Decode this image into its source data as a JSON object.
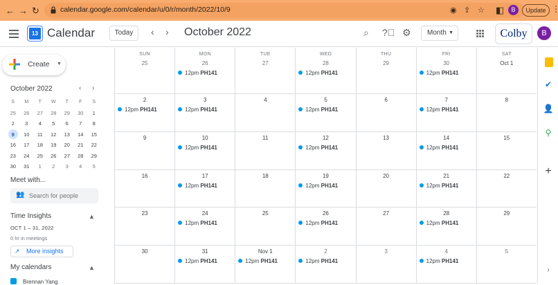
{
  "browser": {
    "url": "calendar.google.com/calendar/u/0/r/month/2022/10/9",
    "profile_initial": "B",
    "update_label": "Update"
  },
  "header": {
    "app_name": "Calendar",
    "logo_day": "13",
    "today_label": "Today",
    "month_title": "October 2022",
    "view_label": "Month",
    "org_logo": "Colby",
    "avatar_initial": "B"
  },
  "sidebar": {
    "create_label": "Create",
    "mini_month": "October 2022",
    "mini_weekdays": [
      "S",
      "M",
      "T",
      "W",
      "T",
      "F",
      "S"
    ],
    "mini_weeks": [
      [
        "25",
        "26",
        "27",
        "28",
        "29",
        "30",
        "1"
      ],
      [
        "2",
        "3",
        "4",
        "5",
        "6",
        "7",
        "8"
      ],
      [
        "9",
        "10",
        "11",
        "12",
        "13",
        "14",
        "15"
      ],
      [
        "16",
        "17",
        "18",
        "19",
        "20",
        "21",
        "22"
      ],
      [
        "23",
        "24",
        "25",
        "26",
        "27",
        "28",
        "29"
      ],
      [
        "30",
        "31",
        "1",
        "2",
        "3",
        "4",
        "5"
      ]
    ],
    "selected_day": "9",
    "meet_with": "Meet with...",
    "search_people_placeholder": "Search for people",
    "time_insights": "Time Insights",
    "insights_range": "OCT 1 – 31, 2022",
    "insights_meetings": "0 hr in meetings",
    "more_insights": "More insights",
    "my_calendars": "My calendars",
    "calendar_item": "Brennan Yang",
    "calendar_color": "#039be5"
  },
  "month": {
    "weekdays": [
      "SUN",
      "MON",
      "TUE",
      "WED",
      "THU",
      "FRI",
      "SAT"
    ],
    "weeks": [
      [
        {
          "label": "25",
          "dim": true,
          "events": []
        },
        {
          "label": "26",
          "dim": true,
          "events": [
            {
              "time": "12pm",
              "title": "PH141"
            }
          ]
        },
        {
          "label": "27",
          "dim": true,
          "events": []
        },
        {
          "label": "28",
          "dim": true,
          "events": [
            {
              "time": "12pm",
              "title": "PH141"
            }
          ]
        },
        {
          "label": "29",
          "dim": true,
          "events": []
        },
        {
          "label": "30",
          "dim": true,
          "events": [
            {
              "time": "12pm",
              "title": "PH141"
            }
          ]
        },
        {
          "label": "Oct 1",
          "dim": false,
          "events": []
        }
      ],
      [
        {
          "label": "2",
          "dim": false,
          "events": [
            {
              "time": "12pm",
              "title": "PH141"
            }
          ]
        },
        {
          "label": "3",
          "dim": false,
          "events": [
            {
              "time": "12pm",
              "title": "PH141"
            }
          ]
        },
        {
          "label": "4",
          "dim": false,
          "events": []
        },
        {
          "label": "5",
          "dim": false,
          "events": [
            {
              "time": "12pm",
              "title": "PH141"
            }
          ]
        },
        {
          "label": "6",
          "dim": false,
          "events": []
        },
        {
          "label": "7",
          "dim": false,
          "events": [
            {
              "time": "12pm",
              "title": "PH141"
            }
          ]
        },
        {
          "label": "8",
          "dim": false,
          "events": []
        }
      ],
      [
        {
          "label": "9",
          "dim": false,
          "events": []
        },
        {
          "label": "10",
          "dim": false,
          "events": [
            {
              "time": "12pm",
              "title": "PH141"
            }
          ]
        },
        {
          "label": "11",
          "dim": false,
          "events": []
        },
        {
          "label": "12",
          "dim": false,
          "events": [
            {
              "time": "12pm",
              "title": "PH141"
            }
          ]
        },
        {
          "label": "13",
          "dim": false,
          "events": []
        },
        {
          "label": "14",
          "dim": false,
          "events": [
            {
              "time": "12pm",
              "title": "PH141"
            }
          ]
        },
        {
          "label": "15",
          "dim": false,
          "events": []
        }
      ],
      [
        {
          "label": "16",
          "dim": false,
          "events": []
        },
        {
          "label": "17",
          "dim": false,
          "events": [
            {
              "time": "12pm",
              "title": "PH141"
            }
          ]
        },
        {
          "label": "18",
          "dim": false,
          "events": []
        },
        {
          "label": "19",
          "dim": false,
          "events": [
            {
              "time": "12pm",
              "title": "PH141"
            }
          ]
        },
        {
          "label": "20",
          "dim": false,
          "events": []
        },
        {
          "label": "21",
          "dim": false,
          "events": [
            {
              "time": "12pm",
              "title": "PH141"
            }
          ]
        },
        {
          "label": "22",
          "dim": false,
          "events": []
        }
      ],
      [
        {
          "label": "23",
          "dim": false,
          "events": []
        },
        {
          "label": "24",
          "dim": false,
          "events": [
            {
              "time": "12pm",
              "title": "PH141"
            }
          ]
        },
        {
          "label": "25",
          "dim": false,
          "events": []
        },
        {
          "label": "26",
          "dim": false,
          "events": [
            {
              "time": "12pm",
              "title": "PH141"
            }
          ]
        },
        {
          "label": "27",
          "dim": false,
          "events": []
        },
        {
          "label": "28",
          "dim": false,
          "events": [
            {
              "time": "12pm",
              "title": "PH141"
            }
          ]
        },
        {
          "label": "29",
          "dim": false,
          "events": []
        }
      ],
      [
        {
          "label": "30",
          "dim": false,
          "events": []
        },
        {
          "label": "31",
          "dim": false,
          "events": [
            {
              "time": "12pm",
              "title": "PH141"
            }
          ]
        },
        {
          "label": "Nov 1",
          "dim": false,
          "events": [
            {
              "time": "12pm",
              "title": "PH141"
            }
          ]
        },
        {
          "label": "2",
          "dim": true,
          "events": [
            {
              "time": "12pm",
              "title": "PH141"
            }
          ]
        },
        {
          "label": "3",
          "dim": true,
          "events": []
        },
        {
          "label": "4",
          "dim": true,
          "events": [
            {
              "time": "12pm",
              "title": "PH141"
            }
          ]
        },
        {
          "label": "5",
          "dim": true,
          "events": []
        }
      ]
    ]
  },
  "colors": {
    "chrome": "#f8ac6e",
    "event_dot": "#039be5",
    "accent": "#1a73e8"
  }
}
